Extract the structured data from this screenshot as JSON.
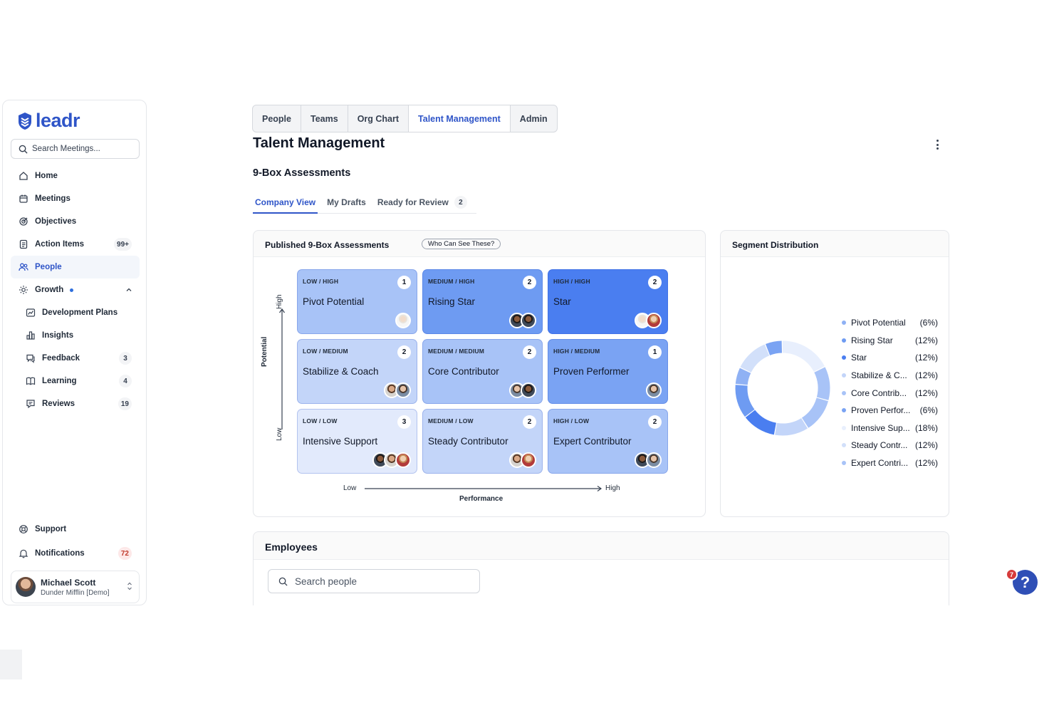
{
  "sidebar": {
    "logo_text": "leadr",
    "search_placeholder": "Search Meetings...",
    "items": [
      {
        "label": "Home",
        "badge": ""
      },
      {
        "label": "Meetings",
        "badge": ""
      },
      {
        "label": "Objectives",
        "badge": ""
      },
      {
        "label": "Action Items",
        "badge": "99+"
      },
      {
        "label": "People",
        "badge": ""
      },
      {
        "label": "Growth",
        "badge": ""
      }
    ],
    "growth_items": [
      {
        "label": "Development Plans",
        "badge": ""
      },
      {
        "label": "Insights",
        "badge": ""
      },
      {
        "label": "Feedback",
        "badge": "3"
      },
      {
        "label": "Learning",
        "badge": "4"
      },
      {
        "label": "Reviews",
        "badge": "19"
      }
    ],
    "support_label": "Support",
    "notifications_label": "Notifications",
    "notifications_count": "72",
    "user": {
      "name": "Michael Scott",
      "org": "Dunder Mifflin [Demo]"
    }
  },
  "top_tabs": [
    "People",
    "Teams",
    "Org Chart",
    "Talent Management",
    "Admin"
  ],
  "page_title": "Talent Management",
  "section_title": "9-Box Assessments",
  "sub_tabs": {
    "company": "Company View",
    "drafts": "My Drafts",
    "review": "Ready for Review",
    "review_count": "2"
  },
  "ninebox": {
    "title": "Published 9-Box Assessments",
    "who_label": "Who Can See These?",
    "y_axis": "Potential",
    "y_high": "High",
    "y_low": "Low",
    "x_axis": "Performance",
    "x_low": "Low",
    "x_high": "High",
    "boxes": [
      {
        "label": "LOW / HIGH",
        "name": "Pivot Potential",
        "count": "1",
        "color": "#a8c3f7"
      },
      {
        "label": "MEDIUM / HIGH",
        "name": "Rising Star",
        "count": "2",
        "color": "#6e9bf2"
      },
      {
        "label": "HIGH / HIGH",
        "name": "Star",
        "count": "2",
        "color": "#4a7ef0"
      },
      {
        "label": "LOW / MEDIUM",
        "name": "Stabilize & Coach",
        "count": "2",
        "color": "#c3d5f9"
      },
      {
        "label": "MEDIUM / MEDIUM",
        "name": "Core Contributor",
        "count": "2",
        "color": "#a8c3f7"
      },
      {
        "label": "HIGH / MEDIUM",
        "name": "Proven Performer",
        "count": "1",
        "color": "#7aa3f3"
      },
      {
        "label": "LOW / LOW",
        "name": "Intensive Support",
        "count": "3",
        "color": "#e2eafc"
      },
      {
        "label": "MEDIUM / LOW",
        "name": "Steady Contributor",
        "count": "2",
        "color": "#c3d5f9"
      },
      {
        "label": "HIGH / LOW",
        "name": "Expert Contributor",
        "count": "2",
        "color": "#a8c3f7"
      }
    ]
  },
  "segment": {
    "title": "Segment Distribution",
    "items": [
      {
        "name": "Pivot Potential",
        "pct": "(6%)",
        "value": 6,
        "color": "#8fb1f4"
      },
      {
        "name": "Rising Star",
        "pct": "(12%)",
        "value": 12,
        "color": "#6e9bf2"
      },
      {
        "name": "Star",
        "pct": "(12%)",
        "value": 12,
        "color": "#4a7ef0"
      },
      {
        "name": "Stabilize & C...",
        "pct": "(12%)",
        "value": 12,
        "color": "#c3d5f9"
      },
      {
        "name": "Core Contrib...",
        "pct": "(12%)",
        "value": 12,
        "color": "#a8c3f7"
      },
      {
        "name": "Proven Perfor...",
        "pct": "(6%)",
        "value": 6,
        "color": "#7aa3f3"
      },
      {
        "name": "Intensive Sup...",
        "pct": "(18%)",
        "value": 18,
        "color": "#e8effd"
      },
      {
        "name": "Steady Contr...",
        "pct": "(12%)",
        "value": 12,
        "color": "#d2e0fa"
      },
      {
        "name": "Expert Contri...",
        "pct": "(12%)",
        "value": 12,
        "color": "#a8c3f7"
      }
    ]
  },
  "employees": {
    "title": "Employees",
    "search_placeholder": "Search people"
  },
  "help": {
    "badge": "7",
    "label": "?"
  }
}
